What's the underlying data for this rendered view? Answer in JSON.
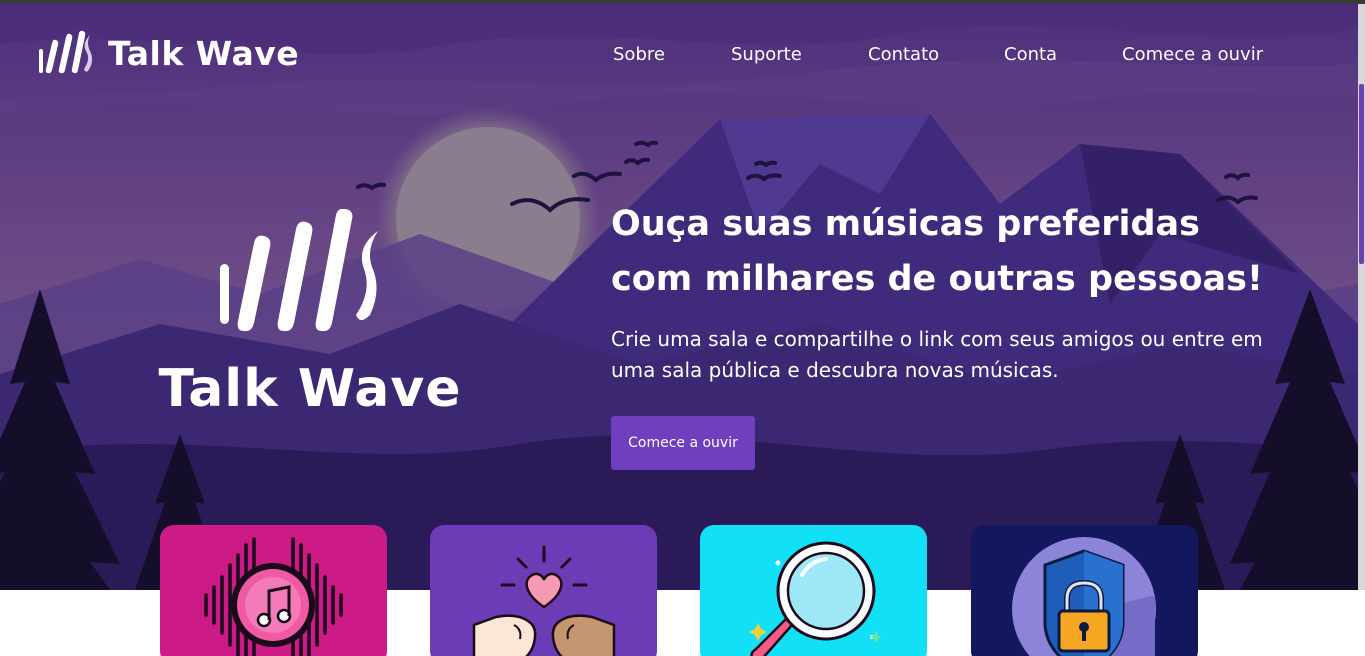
{
  "brand": {
    "name": "Talk Wave"
  },
  "nav": {
    "items": [
      {
        "label": "Sobre"
      },
      {
        "label": "Suporte"
      },
      {
        "label": "Contato"
      },
      {
        "label": "Conta"
      },
      {
        "label": "Comece a ouvir"
      }
    ]
  },
  "hero": {
    "title": "Ouça suas músicas preferidas com milhares de outras pessoas!",
    "subtitle": "Crie uma sala e compartilhe o link com seus amigos ou entre em uma sala pública e descubra novas músicas.",
    "cta_label": "Comece a ouvir"
  },
  "features": [
    {
      "icon": "music-sound-wave-icon",
      "color": "#cc1a86"
    },
    {
      "icon": "fist-bump-heart-icon",
      "color": "#6c3bb6"
    },
    {
      "icon": "magnifying-glass-icon",
      "color": "#12e0f6"
    },
    {
      "icon": "security-lock-shield-icon",
      "color": "#13175e"
    }
  ],
  "colors": {
    "sky_top": "#4a2d78",
    "sky_bottom": "#7a5c8a",
    "mountain": "#3f2a7a",
    "accent": "#6f3fbd",
    "trees": "#140d28"
  }
}
